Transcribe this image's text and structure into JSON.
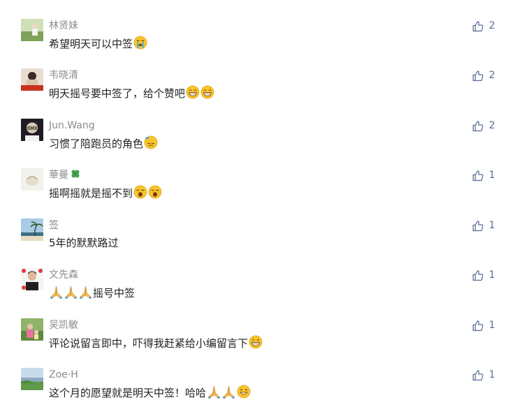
{
  "comments": [
    {
      "name": "林贤妹",
      "text": "希望明天可以中签",
      "emojis": [
        "crying-face"
      ],
      "likes": "2"
    },
    {
      "name": "韦晓清",
      "text": "明天摇号要中签了，给个赞吧",
      "emojis": [
        "grinning-face",
        "grinning-face"
      ],
      "likes": "2"
    },
    {
      "name": "Jun.Wang",
      "text": "习惯了陪跑员的角色",
      "emojis": [
        "sweat-face"
      ],
      "likes": "2"
    },
    {
      "name": "華曼",
      "name_emoji": "four-leaf-clover",
      "text": "摇啊摇就是摇不到",
      "emojis": [
        "yawning-face",
        "yawning-face"
      ],
      "likes": "1"
    },
    {
      "name": "签",
      "text": "5年的默默路过",
      "emojis": [],
      "likes": "1"
    },
    {
      "name": "文先森",
      "text": "摇号中签",
      "leading_emojis": [
        "folded-hands",
        "folded-hands",
        "folded-hands"
      ],
      "emojis": [],
      "likes": "1"
    },
    {
      "name": "吴凯敏",
      "text": "评论说留言即中，吓得我赶紧给小编留言下",
      "emojis": [
        "grinning-face"
      ],
      "likes": "1"
    },
    {
      "name": "Zoe·H",
      "text": "这个月的愿望就是明天中签！哈哈",
      "emojis": [
        "folded-hands",
        "folded-hands",
        "smiling-face"
      ],
      "likes": "1"
    }
  ],
  "icons": {
    "like": "thumbs-up-outline-icon"
  },
  "colors": {
    "name": "#8c8c8c",
    "text": "#222222",
    "like": "#576b95"
  }
}
